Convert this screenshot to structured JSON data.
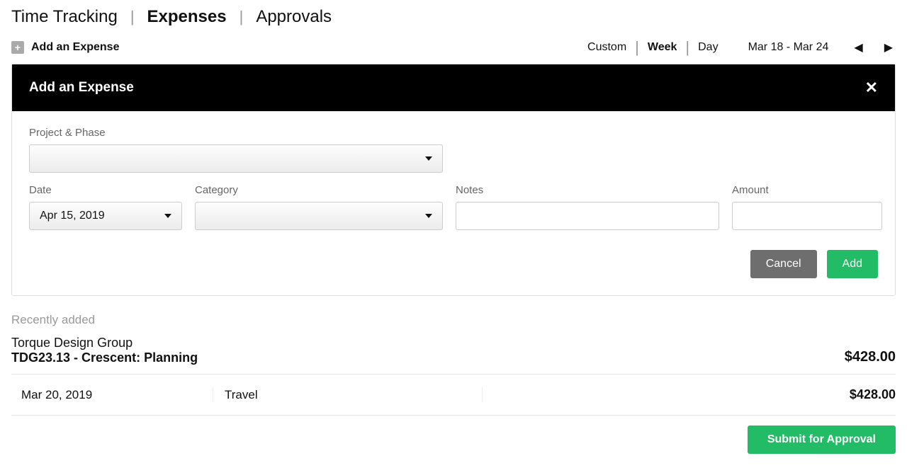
{
  "nav": {
    "tabs": [
      "Time Tracking",
      "Expenses",
      "Approvals"
    ],
    "active_index": 1
  },
  "toolbar": {
    "add_expense_label": "Add an Expense",
    "view_options": [
      "Custom",
      "Week",
      "Day"
    ],
    "view_active_index": 1,
    "date_range": "Mar 18 - Mar 24"
  },
  "panel": {
    "title": "Add an Expense",
    "labels": {
      "project_phase": "Project & Phase",
      "date": "Date",
      "category": "Category",
      "notes": "Notes",
      "amount": "Amount"
    },
    "values": {
      "project_phase": "",
      "date": "Apr 15, 2019",
      "category": "",
      "notes": "",
      "amount": ""
    },
    "buttons": {
      "cancel": "Cancel",
      "add": "Add"
    }
  },
  "recent": {
    "heading": "Recently added",
    "group": {
      "client": "Torque Design Group",
      "project": "TDG23.13 - Crescent: Planning",
      "total": "$428.00"
    },
    "entries": [
      {
        "date": "Mar 20, 2019",
        "category": "Travel",
        "amount": "$428.00"
      }
    ]
  },
  "submit": {
    "label": "Submit for Approval"
  }
}
